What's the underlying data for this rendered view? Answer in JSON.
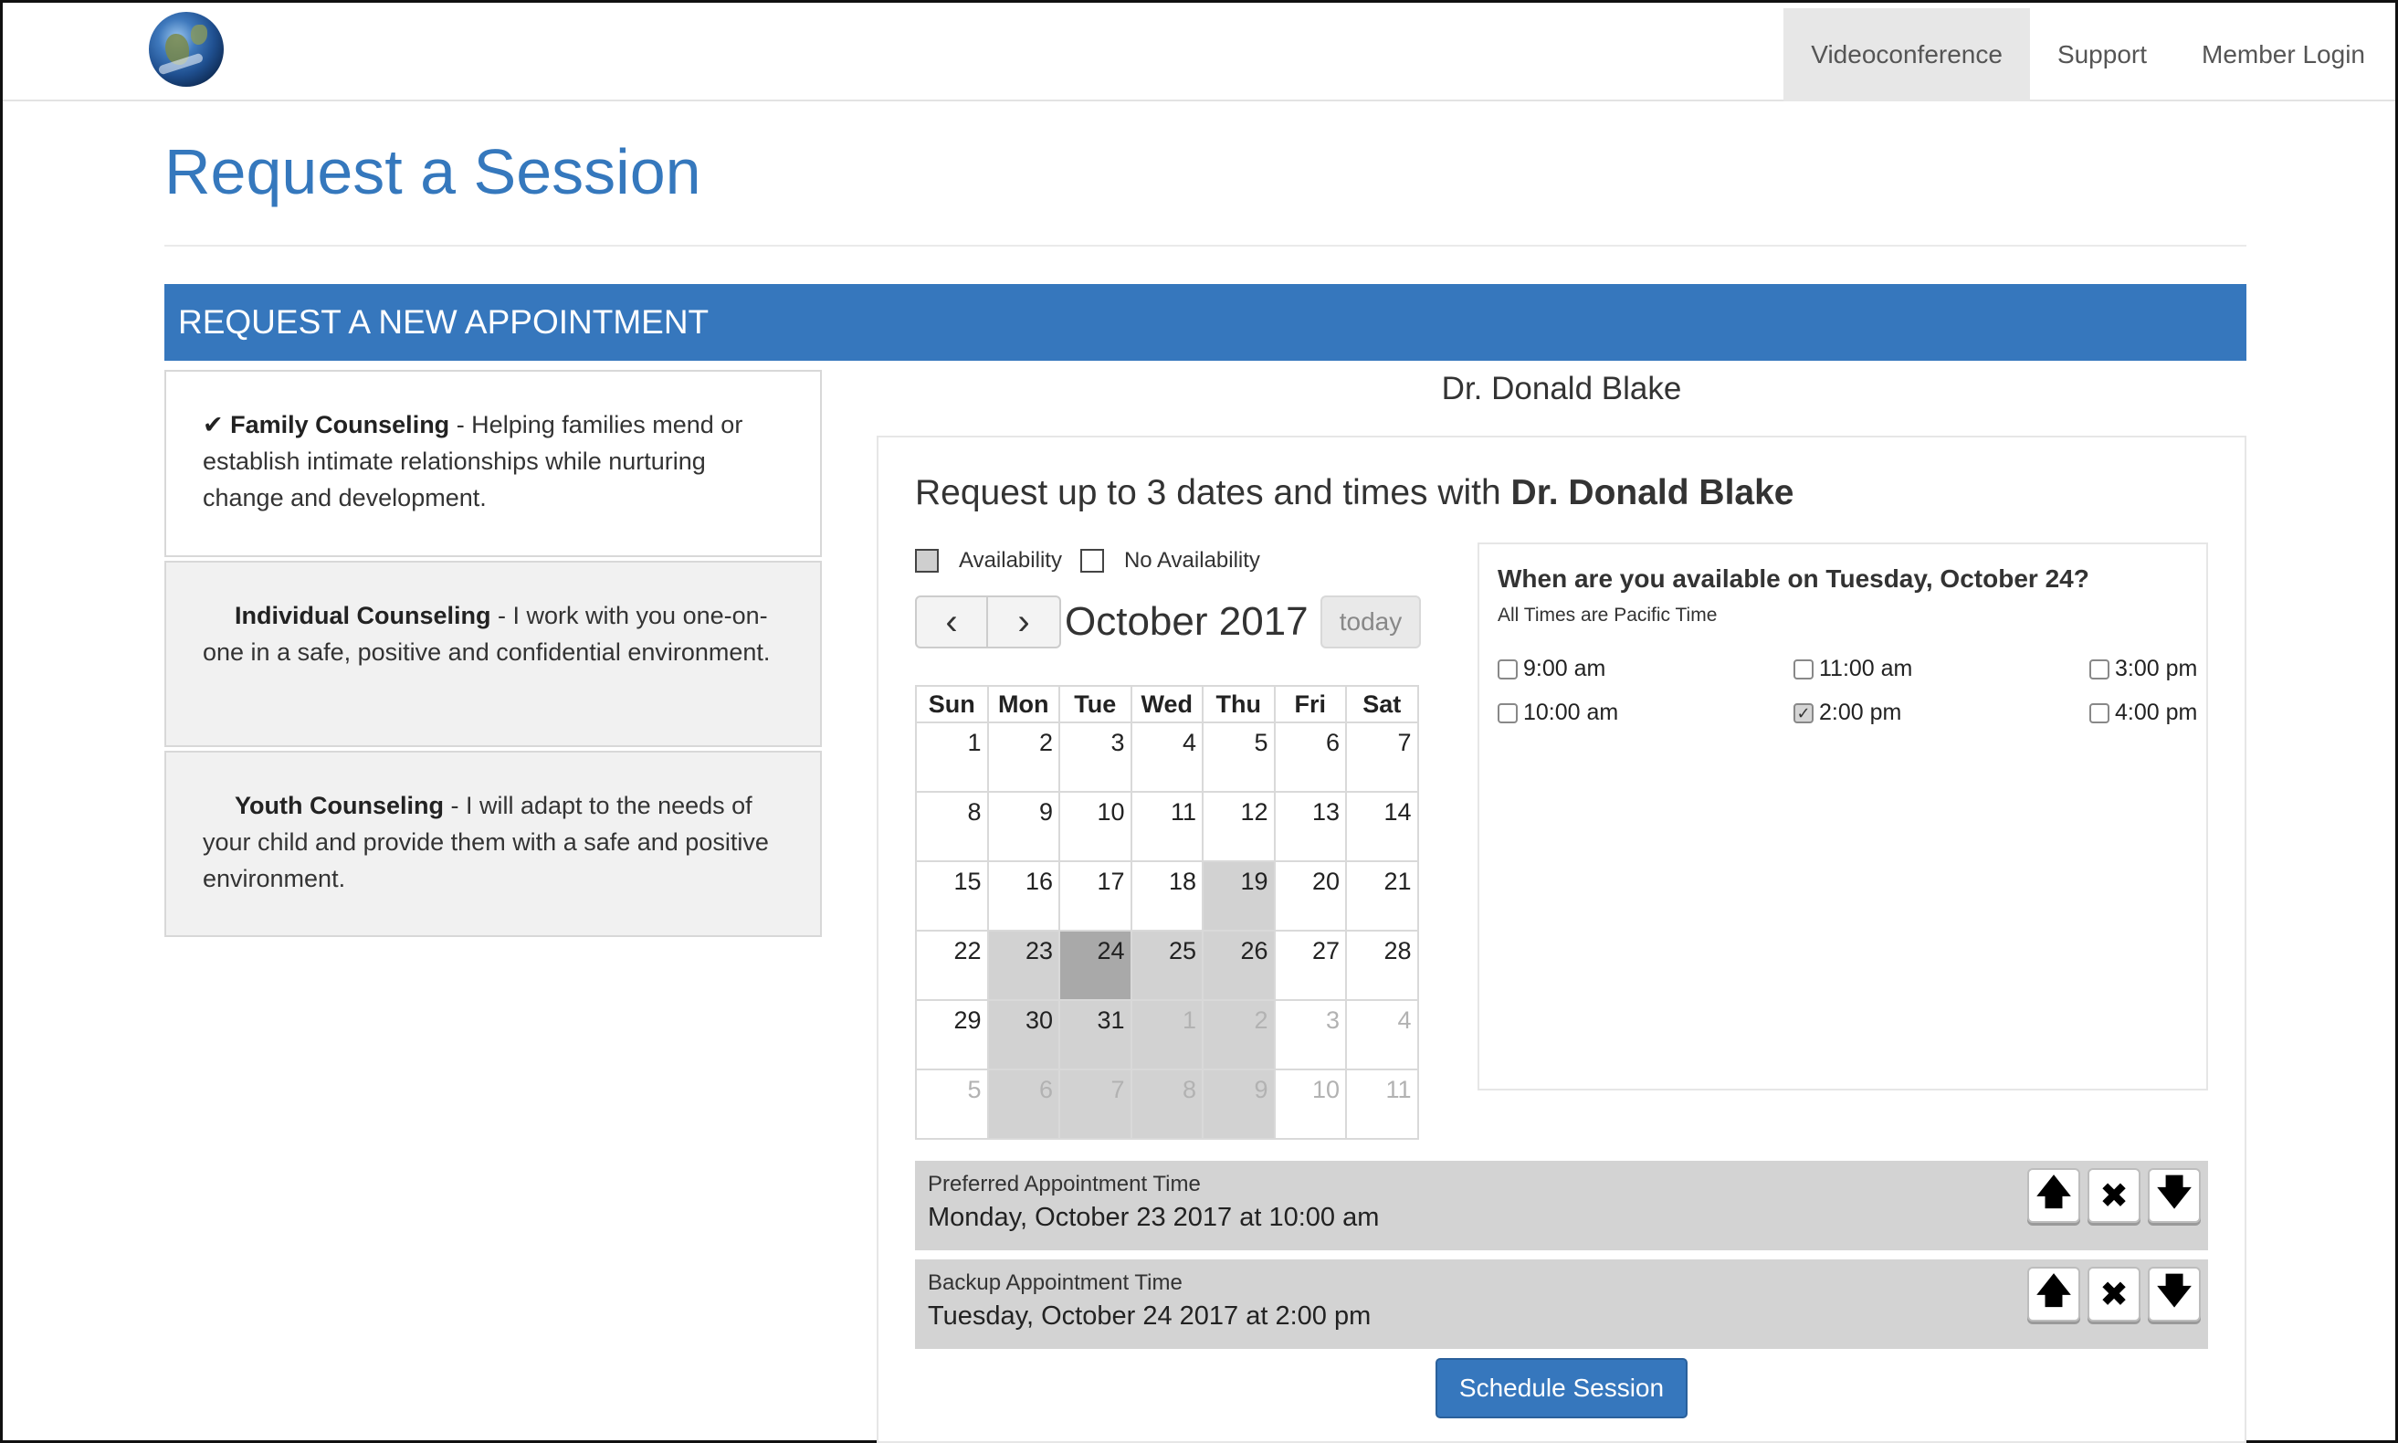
{
  "nav": {
    "links": [
      "Videoconference",
      "Support",
      "Member Login"
    ]
  },
  "page_title": "Request a Session",
  "banner": "REQUEST A NEW APPOINTMENT",
  "services": [
    {
      "name": "Family Counseling",
      "desc": " - Helping families mend or establish intimate relationships while nurturing change and development.",
      "selected": true
    },
    {
      "name": "Individual Counseling",
      "desc": " - I work with you one-on-one in a safe, positive and confidential environment.",
      "selected": false
    },
    {
      "name": "Youth Counseling",
      "desc": " - I will adapt to the needs of your child and provide them with a safe and positive environment.",
      "selected": false
    }
  ],
  "doctor": "Dr. Donald Blake",
  "request": {
    "prefix": "Request up to 3 dates and times with ",
    "doctor": "Dr. Donald Blake"
  },
  "legend": {
    "availability": "Availability",
    "no_availability": "No Availability"
  },
  "calendar": {
    "month": "October 2017",
    "today_label": "today",
    "prev_glyph": "‹",
    "next_glyph": "›",
    "weekdays": [
      "Sun",
      "Mon",
      "Tue",
      "Wed",
      "Thu",
      "Fri",
      "Sat"
    ],
    "weeks": [
      [
        {
          "d": "1"
        },
        {
          "d": "2"
        },
        {
          "d": "3"
        },
        {
          "d": "4"
        },
        {
          "d": "5"
        },
        {
          "d": "6"
        },
        {
          "d": "7"
        }
      ],
      [
        {
          "d": "8"
        },
        {
          "d": "9"
        },
        {
          "d": "10"
        },
        {
          "d": "11"
        },
        {
          "d": "12"
        },
        {
          "d": "13"
        },
        {
          "d": "14"
        }
      ],
      [
        {
          "d": "15"
        },
        {
          "d": "16"
        },
        {
          "d": "17"
        },
        {
          "d": "18"
        },
        {
          "d": "19",
          "s": "avail"
        },
        {
          "d": "20"
        },
        {
          "d": "21"
        }
      ],
      [
        {
          "d": "22"
        },
        {
          "d": "23",
          "s": "avail"
        },
        {
          "d": "24",
          "s": "selected"
        },
        {
          "d": "25",
          "s": "avail"
        },
        {
          "d": "26",
          "s": "avail"
        },
        {
          "d": "27"
        },
        {
          "d": "28"
        }
      ],
      [
        {
          "d": "29"
        },
        {
          "d": "30",
          "s": "avail"
        },
        {
          "d": "31",
          "s": "avail"
        },
        {
          "d": "1",
          "s": "avail",
          "o": true
        },
        {
          "d": "2",
          "s": "avail",
          "o": true
        },
        {
          "d": "3",
          "o": true
        },
        {
          "d": "4",
          "o": true
        }
      ],
      [
        {
          "d": "5",
          "o": true
        },
        {
          "d": "6",
          "s": "avail",
          "o": true
        },
        {
          "d": "7",
          "s": "avail",
          "o": true
        },
        {
          "d": "8",
          "s": "avail",
          "o": true
        },
        {
          "d": "9",
          "s": "avail",
          "o": true
        },
        {
          "d": "10",
          "o": true
        },
        {
          "d": "11",
          "o": true
        }
      ]
    ]
  },
  "times": {
    "question": "When are you available on Tuesday, October 24?",
    "note": "All Times are Pacific Time",
    "slots": [
      {
        "label": "9:00 am",
        "checked": false
      },
      {
        "label": "11:00 am",
        "checked": false
      },
      {
        "label": "3:00 pm",
        "checked": false
      },
      {
        "label": "10:00 am",
        "checked": false
      },
      {
        "label": "2:00 pm",
        "checked": true
      },
      {
        "label": "4:00 pm",
        "checked": false
      }
    ]
  },
  "appointments": [
    {
      "label": "Preferred Appointment Time",
      "value": "Monday, October 23 2017 at 10:00 am"
    },
    {
      "label": "Backup Appointment Time",
      "value": "Tuesday, October 24 2017 at 2:00 pm"
    }
  ],
  "controls": {
    "up": "🡅",
    "remove": "✖",
    "down": "🡇"
  },
  "schedule_button": "Schedule Session"
}
